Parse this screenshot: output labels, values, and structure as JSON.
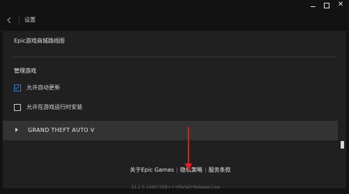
{
  "window": {
    "minimize_icon": "minimize-icon",
    "maximize_icon": "maximize-icon",
    "close_icon": "close-icon",
    "close_glyph": "✕"
  },
  "header": {
    "back_icon": "back-arrow-icon",
    "title": "设置"
  },
  "routes": {
    "label": "Epic游戏商城路线图"
  },
  "manage_games": {
    "title": "管理游戏",
    "options": [
      {
        "label": "允许自动更新",
        "checked": true
      },
      {
        "label": "允许在游戏运行时安装",
        "checked": false
      }
    ]
  },
  "game_item": {
    "name": "GRAND THEFT AUTO V",
    "expand_icon": "caret-right-icon"
  },
  "footer": {
    "about": "关于Epic Games",
    "privacy": "隐私策略",
    "terms": "服务条款",
    "separator": "|"
  },
  "annotation": {
    "color": "#e02020"
  },
  "version": "12.2.5-16457358+++Portal+Release-Live",
  "colors": {
    "accent": "#2e7fd8",
    "background": "#121212",
    "panel": "#202020",
    "row": "#333333"
  }
}
